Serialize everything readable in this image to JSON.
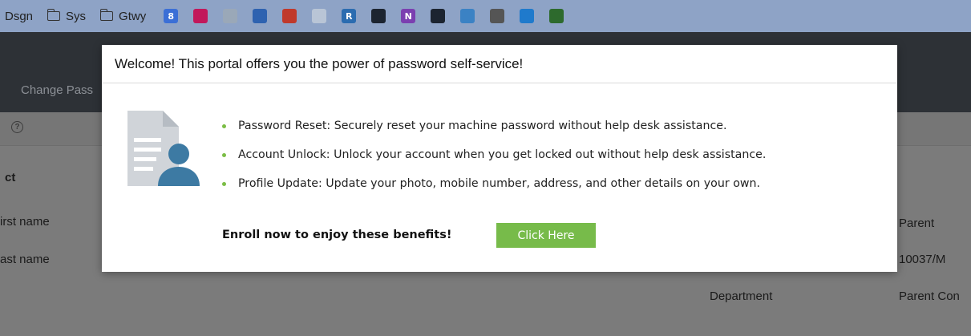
{
  "bookmarks": {
    "items": [
      {
        "label": "Dsgn",
        "type": "text"
      },
      {
        "label": "Sys",
        "type": "folder"
      },
      {
        "label": "Gtwy",
        "type": "folder"
      }
    ],
    "icons": [
      {
        "name": "calendar-icon",
        "glyph": "8",
        "color": "#3b6fd6"
      },
      {
        "name": "profile-app-icon",
        "glyph": "",
        "color": "#c2185b"
      },
      {
        "name": "robot-icon",
        "glyph": "",
        "color": "#9aa8b8"
      },
      {
        "name": "form-icon",
        "glyph": "",
        "color": "#2e62b0"
      },
      {
        "name": "grid-app-icon",
        "glyph": "",
        "color": "#c0392b"
      },
      {
        "name": "document-icon",
        "glyph": "",
        "color": "#b9c5d6"
      },
      {
        "name": "r-app-icon",
        "glyph": "R",
        "color": "#2b6cb0"
      },
      {
        "name": "globe-icon",
        "glyph": "",
        "color": "#1c2430"
      },
      {
        "name": "onenote-icon",
        "glyph": "N",
        "color": "#7b3fb0"
      },
      {
        "name": "globe-icon-2",
        "glyph": "",
        "color": "#1c2430"
      },
      {
        "name": "puzzle-icon",
        "glyph": "",
        "color": "#3b82c4"
      },
      {
        "name": "apple-icon",
        "glyph": "",
        "color": "#555555"
      },
      {
        "name": "exchange-icon",
        "glyph": "",
        "color": "#1f7acc"
      },
      {
        "name": "terminal-app-icon",
        "glyph": "",
        "color": "#2d6a2d"
      }
    ]
  },
  "page": {
    "tab_label": "Change Pass",
    "help_glyph": "?",
    "section_label": "ct",
    "first_name_label": "irst name",
    "last_name_label": "ast name",
    "parent_label": "Parent",
    "parent_value": "10037/M",
    "department_label": "Department",
    "parent_con_label": "Parent Con"
  },
  "modal": {
    "title": "Welcome! This portal offers you the power of password self-service!",
    "benefits": [
      "Password Reset: Securely reset your machine password without help desk assistance.",
      "Account Unlock: Unlock your account when you get locked out without help desk assistance.",
      "Profile Update: Update your photo, mobile number, address, and other details on your own."
    ],
    "enroll_text": "Enroll now to enjoy these benefits!",
    "cta_label": "Click Here"
  },
  "colors": {
    "bookmark_bar": "#8ea3c6",
    "header": "#2d3136",
    "accent_green": "#77bb4a",
    "bullet_green": "#7bbd45"
  }
}
